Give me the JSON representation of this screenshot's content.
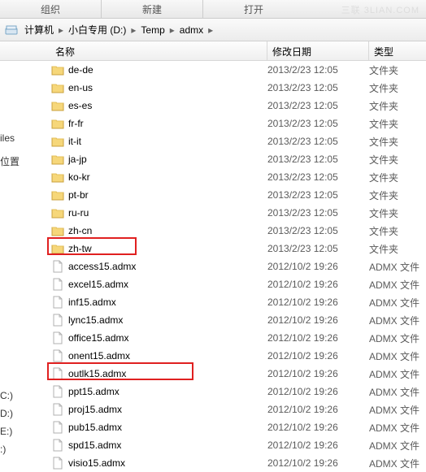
{
  "toolbar": {
    "organize": "组织",
    "new": "新建",
    "open_hint": "打开"
  },
  "watermark": "三联 3LIAN.COM",
  "breadcrumb": [
    {
      "label": "计算机"
    },
    {
      "label": "小白专用 (D:)"
    },
    {
      "label": "Temp"
    },
    {
      "label": "admx"
    }
  ],
  "columns": {
    "name": "名称",
    "date": "修改日期",
    "type": "类型"
  },
  "sidebar_fragments": {
    "iles": "iles",
    "location": "位置",
    "c": "C:)",
    "d": "D:)",
    "e": "E:)",
    "dot": ":)"
  },
  "rows": [
    {
      "icon": "folder",
      "name": "de-de",
      "date": "2013/2/23 12:05",
      "type": "文件夹"
    },
    {
      "icon": "folder",
      "name": "en-us",
      "date": "2013/2/23 12:05",
      "type": "文件夹"
    },
    {
      "icon": "folder",
      "name": "es-es",
      "date": "2013/2/23 12:05",
      "type": "文件夹"
    },
    {
      "icon": "folder",
      "name": "fr-fr",
      "date": "2013/2/23 12:05",
      "type": "文件夹"
    },
    {
      "icon": "folder",
      "name": "it-it",
      "date": "2013/2/23 12:05",
      "type": "文件夹"
    },
    {
      "icon": "folder",
      "name": "ja-jp",
      "date": "2013/2/23 12:05",
      "type": "文件夹"
    },
    {
      "icon": "folder",
      "name": "ko-kr",
      "date": "2013/2/23 12:05",
      "type": "文件夹"
    },
    {
      "icon": "folder",
      "name": "pt-br",
      "date": "2013/2/23 12:05",
      "type": "文件夹"
    },
    {
      "icon": "folder",
      "name": "ru-ru",
      "date": "2013/2/23 12:05",
      "type": "文件夹"
    },
    {
      "icon": "folder",
      "name": "zh-cn",
      "date": "2013/2/23 12:05",
      "type": "文件夹"
    },
    {
      "icon": "folder",
      "name": "zh-tw",
      "date": "2013/2/23 12:05",
      "type": "文件夹"
    },
    {
      "icon": "file",
      "name": "access15.admx",
      "date": "2012/10/2 19:26",
      "type": "ADMX 文件"
    },
    {
      "icon": "file",
      "name": "excel15.admx",
      "date": "2012/10/2 19:26",
      "type": "ADMX 文件"
    },
    {
      "icon": "file",
      "name": "inf15.admx",
      "date": "2012/10/2 19:26",
      "type": "ADMX 文件"
    },
    {
      "icon": "file",
      "name": "lync15.admx",
      "date": "2012/10/2 19:26",
      "type": "ADMX 文件"
    },
    {
      "icon": "file",
      "name": "office15.admx",
      "date": "2012/10/2 19:26",
      "type": "ADMX 文件"
    },
    {
      "icon": "file",
      "name": "onent15.admx",
      "date": "2012/10/2 19:26",
      "type": "ADMX 文件"
    },
    {
      "icon": "file",
      "name": "outlk15.admx",
      "date": "2012/10/2 19:26",
      "type": "ADMX 文件"
    },
    {
      "icon": "file",
      "name": "ppt15.admx",
      "date": "2012/10/2 19:26",
      "type": "ADMX 文件"
    },
    {
      "icon": "file",
      "name": "proj15.admx",
      "date": "2012/10/2 19:26",
      "type": "ADMX 文件"
    },
    {
      "icon": "file",
      "name": "pub15.admx",
      "date": "2012/10/2 19:26",
      "type": "ADMX 文件"
    },
    {
      "icon": "file",
      "name": "spd15.admx",
      "date": "2012/10/2 19:26",
      "type": "ADMX 文件"
    },
    {
      "icon": "file",
      "name": "visio15.admx",
      "date": "2012/10/2 19:26",
      "type": "ADMX 文件"
    }
  ]
}
